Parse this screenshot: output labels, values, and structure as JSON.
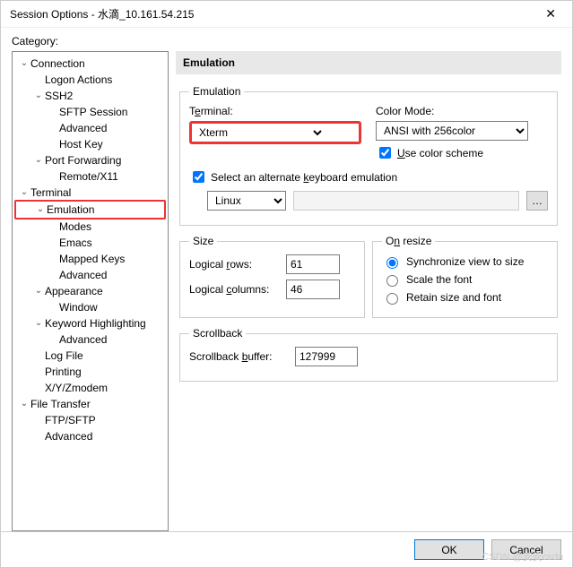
{
  "window": {
    "title": "Session Options - 水滴_10.161.54.215"
  },
  "category_label": "Category:",
  "tree": [
    {
      "label": "Connection",
      "depth": 0,
      "exp": true
    },
    {
      "label": "Logon Actions",
      "depth": 1
    },
    {
      "label": "SSH2",
      "depth": 1,
      "exp": true
    },
    {
      "label": "SFTP Session",
      "depth": 2
    },
    {
      "label": "Advanced",
      "depth": 2
    },
    {
      "label": "Host Key",
      "depth": 2
    },
    {
      "label": "Port Forwarding",
      "depth": 1,
      "exp": true
    },
    {
      "label": "Remote/X11",
      "depth": 2
    },
    {
      "label": "Terminal",
      "depth": 0,
      "exp": true
    },
    {
      "label": "Emulation",
      "depth": 1,
      "exp": true,
      "sel": true
    },
    {
      "label": "Modes",
      "depth": 2
    },
    {
      "label": "Emacs",
      "depth": 2
    },
    {
      "label": "Mapped Keys",
      "depth": 2
    },
    {
      "label": "Advanced",
      "depth": 2
    },
    {
      "label": "Appearance",
      "depth": 1,
      "exp": true
    },
    {
      "label": "Window",
      "depth": 2
    },
    {
      "label": "Keyword Highlighting",
      "depth": 1,
      "exp": true
    },
    {
      "label": "Advanced",
      "depth": 2
    },
    {
      "label": "Log File",
      "depth": 1
    },
    {
      "label": "Printing",
      "depth": 1
    },
    {
      "label": "X/Y/Zmodem",
      "depth": 1
    },
    {
      "label": "File Transfer",
      "depth": 0,
      "exp": true
    },
    {
      "label": "FTP/SFTP",
      "depth": 1
    },
    {
      "label": "Advanced",
      "depth": 1
    }
  ],
  "panel": {
    "title": "Emulation",
    "emu_group": "Emulation",
    "terminal_label": "Terminal:",
    "terminal_value": "Xterm",
    "color_mode_label": "Color Mode:",
    "color_mode_value": "ANSI with 256color",
    "use_color_scheme": "Use color scheme",
    "alt_kbd": "Select an alternate keyboard emulation",
    "kbd_value": "Linux",
    "size_group": "Size",
    "logical_rows_label": "Logical rows:",
    "logical_rows": "61",
    "logical_cols_label": "Logical columns:",
    "logical_cols": "46",
    "resize_group": "On resize",
    "sync": "Synchronize view to size",
    "scale": "Scale the font",
    "retain": "Retain size and font",
    "scrollback_group": "Scrollback",
    "scrollback_label": "Scrollback buffer:",
    "scrollback": "127999"
  },
  "buttons": {
    "ok": "OK",
    "cancel": "Cancel"
  },
  "watermark": "CSDN @安安csdn"
}
